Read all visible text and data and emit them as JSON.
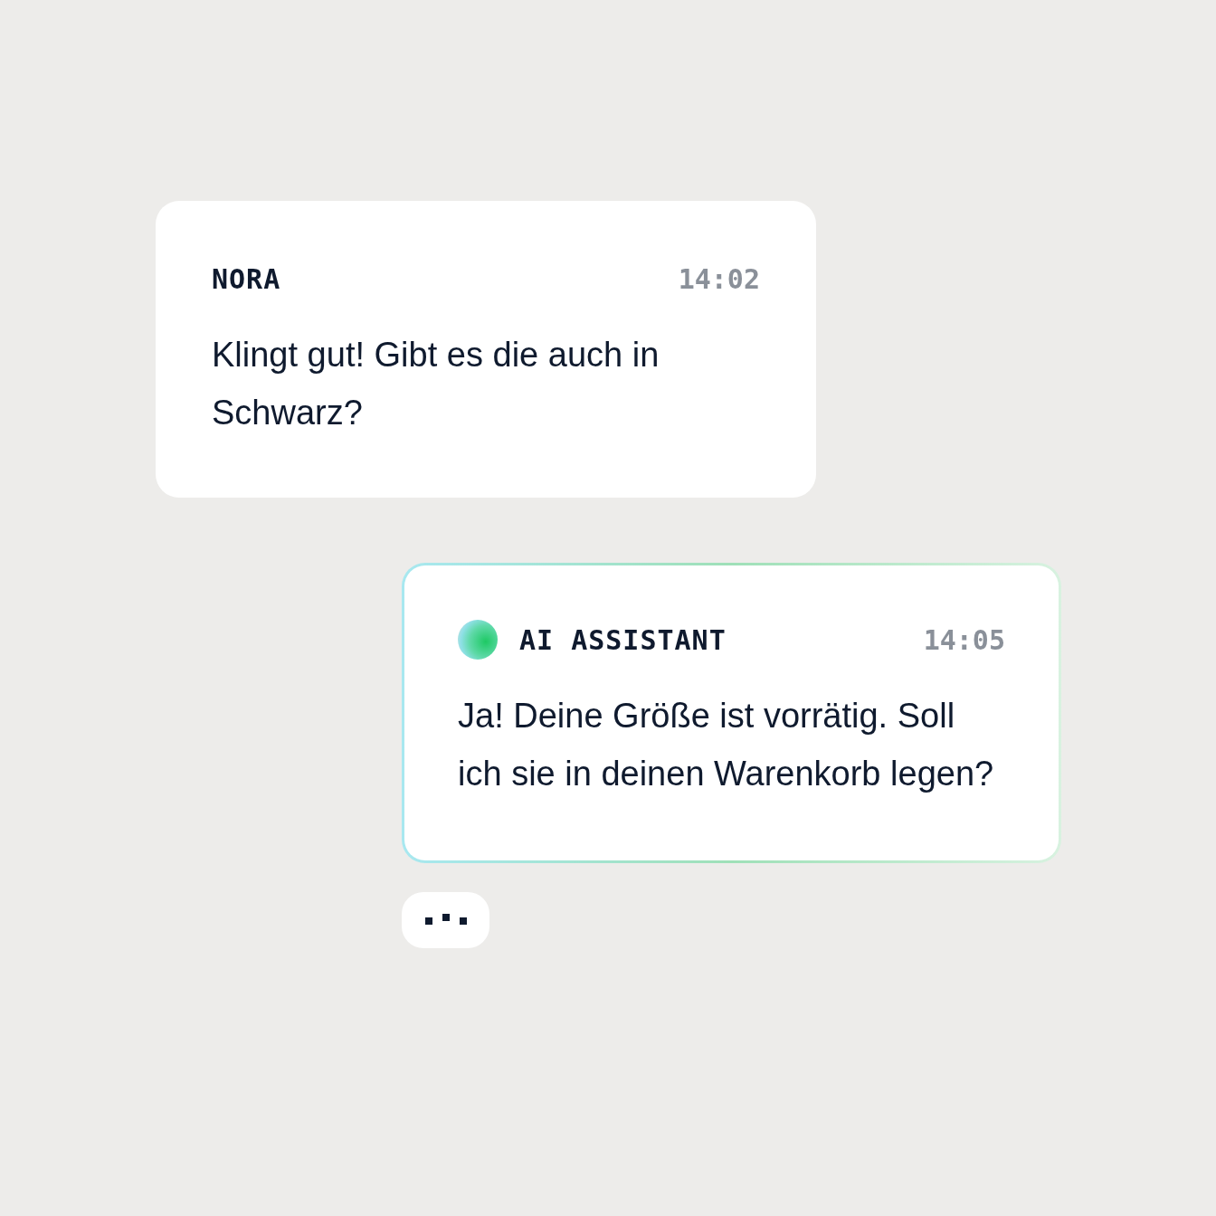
{
  "messages": [
    {
      "kind": "user",
      "sender": "NORA",
      "time": "14:02",
      "text": "Klingt gut! Gibt es die auch in Schwarz?"
    },
    {
      "kind": "assistant",
      "sender": "AI ASSISTANT",
      "time": "14:05",
      "text": "Ja! Deine Größe ist vorrätig. Soll ich sie in deinen Warenkorb legen?"
    }
  ],
  "typing_indicator": {
    "visible": true
  }
}
